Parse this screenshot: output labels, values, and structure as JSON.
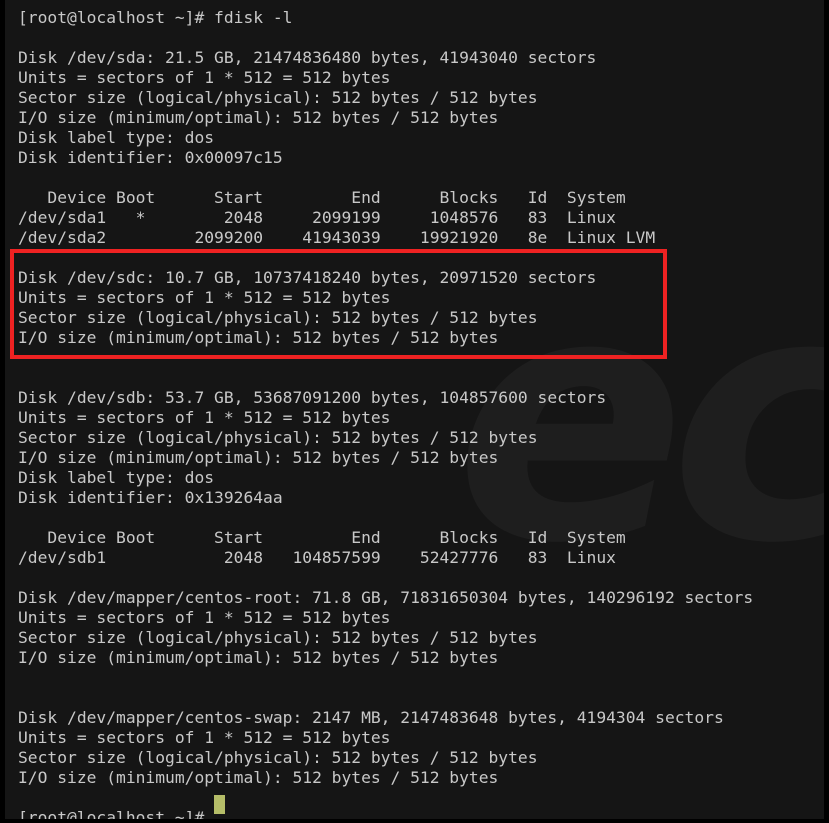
{
  "terminal": {
    "background_color": "#151515",
    "text_color": "#c8c8c8",
    "cursor_color": "#b5bd68",
    "watermark_text": "ec",
    "prompt": "[root@localhost ~]#",
    "command": "fdisk -l",
    "command_line": "[root@localhost ~]# fdisk -l",
    "final_prompt_line": "[root@localhost ~]# "
  },
  "annotation": {
    "color": "#ee2222",
    "target": "disk-dev-sdc-block"
  },
  "disks": [
    {
      "name": "/dev/sda",
      "header": "Disk /dev/sda: 21.5 GB, 21474836480 bytes, 41943040 sectors",
      "size_human": "21.5 GB",
      "size_bytes": "21474836480",
      "sectors": "41943040",
      "units": "Units = sectors of 1 * 512 = 512 bytes",
      "sector_size": "Sector size (logical/physical): 512 bytes / 512 bytes",
      "io_size": "I/O size (minimum/optimal): 512 bytes / 512 bytes",
      "label_type": "Disk label type: dos",
      "identifier": "Disk identifier: 0x00097c15",
      "table": {
        "headers": [
          "Device",
          "Boot",
          "Start",
          "End",
          "Blocks",
          "Id",
          "System"
        ],
        "rows": [
          {
            "device": "/dev/sda1",
            "boot": "*",
            "start": "2048",
            "end": "2099199",
            "blocks": "1048576",
            "id": "83",
            "system": "Linux"
          },
          {
            "device": "/dev/sda2",
            "boot": "",
            "start": "2099200",
            "end": "41943039",
            "blocks": "19921920",
            "id": "8e",
            "system": "Linux LVM"
          }
        ]
      }
    },
    {
      "name": "/dev/sdc",
      "highlighted": true,
      "header": "Disk /dev/sdc: 10.7 GB, 10737418240 bytes, 20971520 sectors",
      "size_human": "10.7 GB",
      "size_bytes": "10737418240",
      "sectors": "20971520",
      "units": "Units = sectors of 1 * 512 = 512 bytes",
      "sector_size": "Sector size (logical/physical): 512 bytes / 512 bytes",
      "io_size": "I/O size (minimum/optimal): 512 bytes / 512 bytes"
    },
    {
      "name": "/dev/sdb",
      "header": "Disk /dev/sdb: 53.7 GB, 53687091200 bytes, 104857600 sectors",
      "size_human": "53.7 GB",
      "size_bytes": "53687091200",
      "sectors": "104857600",
      "units": "Units = sectors of 1 * 512 = 512 bytes",
      "sector_size": "Sector size (logical/physical): 512 bytes / 512 bytes",
      "io_size": "I/O size (minimum/optimal): 512 bytes / 512 bytes",
      "label_type": "Disk label type: dos",
      "identifier": "Disk identifier: 0x139264aa",
      "table": {
        "headers": [
          "Device",
          "Boot",
          "Start",
          "End",
          "Blocks",
          "Id",
          "System"
        ],
        "rows": [
          {
            "device": "/dev/sdb1",
            "boot": "",
            "start": "2048",
            "end": "104857599",
            "blocks": "52427776",
            "id": "83",
            "system": "Linux"
          }
        ]
      }
    },
    {
      "name": "/dev/mapper/centos-root",
      "header": "Disk /dev/mapper/centos-root: 71.8 GB, 71831650304 bytes, 140296192 sectors",
      "size_human": "71.8 GB",
      "size_bytes": "71831650304",
      "sectors": "140296192",
      "units": "Units = sectors of 1 * 512 = 512 bytes",
      "sector_size": "Sector size (logical/physical): 512 bytes / 512 bytes",
      "io_size": "I/O size (minimum/optimal): 512 bytes / 512 bytes"
    },
    {
      "name": "/dev/mapper/centos-swap",
      "header": "Disk /dev/mapper/centos-swap: 2147 MB, 2147483648 bytes, 4194304 sectors",
      "size_human": "2147 MB",
      "size_bytes": "2147483648",
      "sectors": "4194304",
      "units": "Units = sectors of 1 * 512 = 512 bytes",
      "sector_size": "Sector size (logical/physical): 512 bytes / 512 bytes",
      "io_size": "I/O size (minimum/optimal): 512 bytes / 512 bytes"
    }
  ],
  "console_text": "[root@localhost ~]# fdisk -l\n\nDisk /dev/sda: 21.5 GB, 21474836480 bytes, 41943040 sectors\nUnits = sectors of 1 * 512 = 512 bytes\nSector size (logical/physical): 512 bytes / 512 bytes\nI/O size (minimum/optimal): 512 bytes / 512 bytes\nDisk label type: dos\nDisk identifier: 0x00097c15\n\n   Device Boot      Start         End      Blocks   Id  System\n/dev/sda1   *        2048     2099199     1048576   83  Linux\n/dev/sda2         2099200    41943039    19921920   8e  Linux LVM\n\nDisk /dev/sdc: 10.7 GB, 10737418240 bytes, 20971520 sectors\nUnits = sectors of 1 * 512 = 512 bytes\nSector size (logical/physical): 512 bytes / 512 bytes\nI/O size (minimum/optimal): 512 bytes / 512 bytes\n\n\nDisk /dev/sdb: 53.7 GB, 53687091200 bytes, 104857600 sectors\nUnits = sectors of 1 * 512 = 512 bytes\nSector size (logical/physical): 512 bytes / 512 bytes\nI/O size (minimum/optimal): 512 bytes / 512 bytes\nDisk label type: dos\nDisk identifier: 0x139264aa\n\n   Device Boot      Start         End      Blocks   Id  System\n/dev/sdb1            2048   104857599    52427776   83  Linux\n\nDisk /dev/mapper/centos-root: 71.8 GB, 71831650304 bytes, 140296192 sectors\nUnits = sectors of 1 * 512 = 512 bytes\nSector size (logical/physical): 512 bytes / 512 bytes\nI/O size (minimum/optimal): 512 bytes / 512 bytes\n\n\nDisk /dev/mapper/centos-swap: 2147 MB, 2147483648 bytes, 4194304 sectors\nUnits = sectors of 1 * 512 = 512 bytes\nSector size (logical/physical): 512 bytes / 512 bytes\nI/O size (minimum/optimal): 512 bytes / 512 bytes\n\n[root@localhost ~]# "
}
